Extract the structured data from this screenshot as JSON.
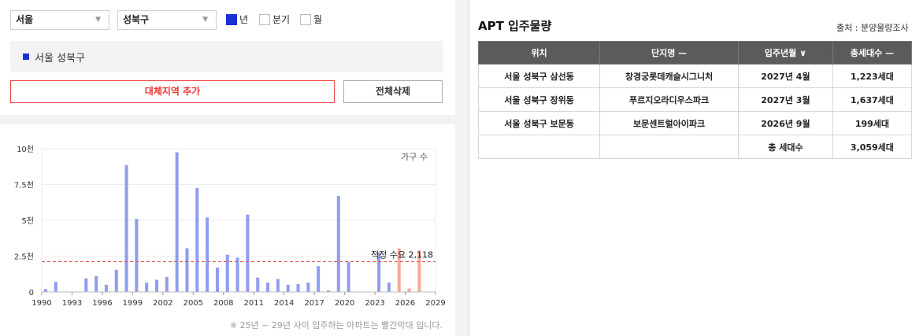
{
  "filters": {
    "city": "서울",
    "district": "성북구",
    "periods": [
      {
        "label": "년",
        "checked": true
      },
      {
        "label": "분기",
        "checked": false
      },
      {
        "label": "월",
        "checked": false
      }
    ]
  },
  "selected_region": "서울 성북구",
  "buttons": {
    "add_region": "대체지역 추가",
    "delete_all": "전체삭제"
  },
  "chart_data": {
    "type": "bar",
    "legend": "가구 수",
    "x": [
      1990,
      1991,
      1992,
      1993,
      1994,
      1995,
      1996,
      1997,
      1998,
      1999,
      2000,
      2001,
      2002,
      2003,
      2004,
      2005,
      2006,
      2007,
      2008,
      2009,
      2010,
      2011,
      2012,
      2013,
      2014,
      2015,
      2016,
      2017,
      2018,
      2019,
      2020,
      2021,
      2022,
      2023,
      2024,
      2025,
      2026,
      2027
    ],
    "values": [
      200,
      700,
      0,
      0,
      950,
      1100,
      500,
      1550,
      8850,
      5100,
      650,
      850,
      1050,
      9750,
      3050,
      7250,
      5200,
      1700,
      2600,
      2400,
      5400,
      1000,
      650,
      900,
      500,
      550,
      650,
      1800,
      100,
      6700,
      2100,
      0,
      0,
      2750,
      650,
      3050,
      250,
      2900
    ],
    "highlight_from": 2025,
    "x_ticks": [
      "1990",
      "1993",
      "1996",
      "1999",
      "2002",
      "2005",
      "2008",
      "2011",
      "2014",
      "2017",
      "2020",
      "2023",
      "2026",
      "2029"
    ],
    "y_ticks": [
      "0",
      "2.5천",
      "5천",
      "7.5천",
      "10천"
    ],
    "ylim": [
      0,
      10000
    ],
    "xlim": [
      1990,
      2029
    ],
    "reference": {
      "label": "적정 수요 2,118",
      "value": 2118
    },
    "grid": true,
    "colors": {
      "bar": "#8f9cf0",
      "highlight": "#f7a999",
      "reference": "#e05555"
    }
  },
  "footnote": "※ 25년 ~ 29년 사이 입주하는 아파트는 빨간막대 입니다.",
  "apt": {
    "title": "APT 입주물량",
    "source": "출처 : 분양물량조사",
    "headers": [
      "위치",
      "단지명 —",
      "입주년월 ∨",
      "총세대수 —"
    ],
    "rows": [
      [
        "서울 성북구 삼선동",
        "창경궁롯데캐슬시그니처",
        "2027년 4월",
        "1,223세대"
      ],
      [
        "서울 성북구 장위동",
        "푸르지오라디우스파크",
        "2027년 3월",
        "1,637세대"
      ],
      [
        "서울 성북구 보문동",
        "보문센트럴아이파크",
        "2026년 9월",
        "199세대"
      ],
      [
        "",
        "",
        "총 세대수",
        "3,059세대"
      ]
    ]
  }
}
